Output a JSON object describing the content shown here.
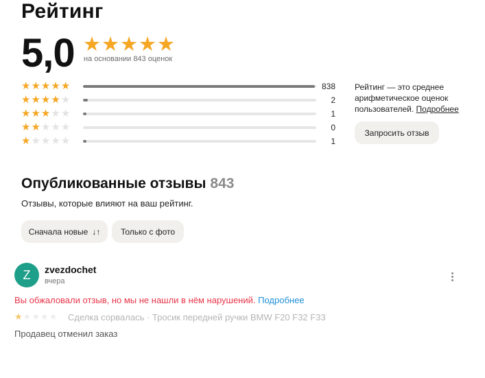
{
  "page_title": "Рейтинг",
  "summary": {
    "rating": "5,0",
    "stars_filled": 5,
    "based_on": "на основании 843 оценок"
  },
  "breakdown": [
    {
      "stars": 5,
      "count": "838",
      "share": 0.994
    },
    {
      "stars": 4,
      "count": "2",
      "share": 0.02
    },
    {
      "stars": 3,
      "count": "1",
      "share": 0.015
    },
    {
      "stars": 2,
      "count": "0",
      "share": 0.0
    },
    {
      "stars": 1,
      "count": "1",
      "share": 0.015
    }
  ],
  "info": {
    "text": "Рейтинг — это среднее арифметическое оценок пользователей.",
    "link": "Подробнее",
    "request_button": "Запросить отзыв"
  },
  "reviews_section": {
    "title": "Опубликованные отзывы",
    "count": "843",
    "subtitle": "Отзывы, которые влияют на ваш рейтинг.",
    "sort_button": "Сначала новые",
    "sort_icon": "sort-arrows-icon",
    "photo_button": "Только с фото"
  },
  "review": {
    "avatar_letter": "Z",
    "avatar_color": "#1e9f8a",
    "user": "zvezdochet",
    "date": "вчера",
    "appeal_text": "Вы обжаловали отзыв, но мы не нашли в нём нарушений.",
    "appeal_link": "Подробнее",
    "stars": 1,
    "deal": "Сделка сорвалась · Тросик передней ручки BMW F20 F32 F33",
    "text": "Продавец отменил заказ"
  },
  "colors": {
    "star": "#f5a623",
    "accent_red": "#e8364a",
    "link_blue": "#1f8fd6"
  }
}
